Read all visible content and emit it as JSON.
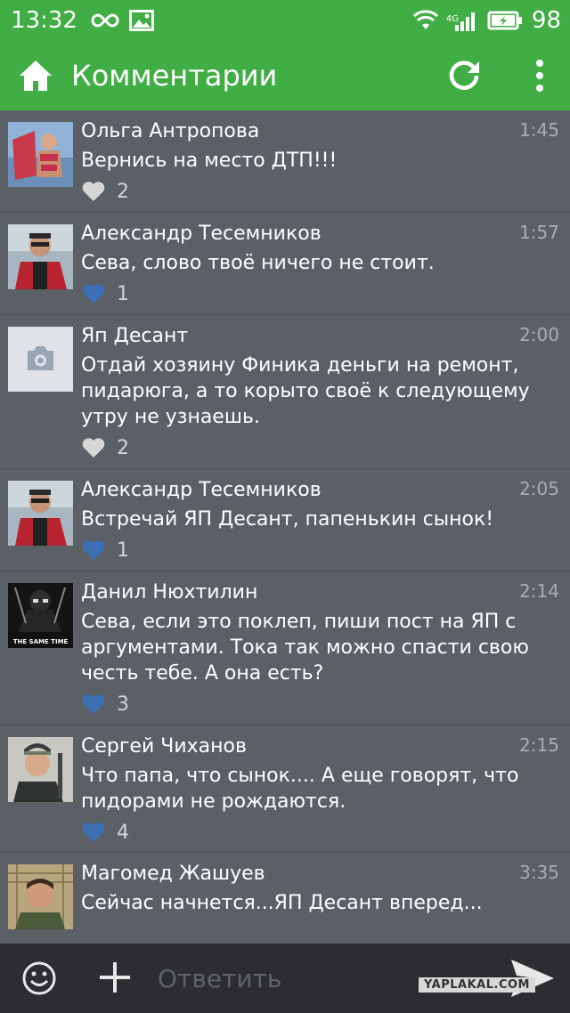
{
  "status_bar": {
    "time": "13:32",
    "network_label": "4G",
    "battery_percent": "98"
  },
  "action_bar": {
    "title": "Комментарии",
    "home_icon": "home-icon",
    "refresh_icon": "refresh-icon",
    "menu_icon": "overflow-menu-icon"
  },
  "comments": [
    {
      "author": "Ольга Антропова",
      "time": "1:45",
      "lines": [
        "Вернись на место ДТП!!!"
      ],
      "likes": "2",
      "liked": false
    },
    {
      "author": "Александр Тесемников",
      "time": "1:57",
      "lines": [
        "Сева, слово твоё ничего не стоит."
      ],
      "likes": "1",
      "liked": true
    },
    {
      "author": "Яп Десант",
      "time": "2:00",
      "lines": [
        "Отдай хозяину Финика деньги на ремонт,",
        "пидарюга, а то корыто своё к следующему",
        "утру не узнаешь."
      ],
      "likes": "2",
      "liked": false
    },
    {
      "author": "Александр Тесемников",
      "time": "2:05",
      "lines": [
        "Встречай ЯП Десант, папенькин сынок!"
      ],
      "likes": "1",
      "liked": true
    },
    {
      "author": "Данил Нюхтилин",
      "time": "2:14",
      "lines": [
        "Сева, если это поклеп, пиши пост на ЯП с",
        "аргументами. Тока так можно спасти свою",
        "честь тебе. А она есть?"
      ],
      "likes": "3",
      "liked": true,
      "avatar_caption": "THE SAME TIME AS"
    },
    {
      "author": "Сергей Чиханов",
      "time": "2:15",
      "lines": [
        "Что папа, что сынок.... А еще говорят, что",
        "пидорами не рождаются."
      ],
      "likes": "4",
      "liked": true
    },
    {
      "author": "Магомед Жашуев",
      "time": "3:35",
      "lines": [
        "Сейчас начнется...ЯП Десант вперед..."
      ],
      "likes": "",
      "liked": false
    }
  ],
  "bottom_bar": {
    "reply_placeholder": "Ответить",
    "watermark": "YAPLAKAL.COM"
  },
  "colors": {
    "accent": "#41ad45",
    "background": "#5b5f66",
    "like_active": "#3c6fb3",
    "like_inactive": "#d6d6d6"
  }
}
